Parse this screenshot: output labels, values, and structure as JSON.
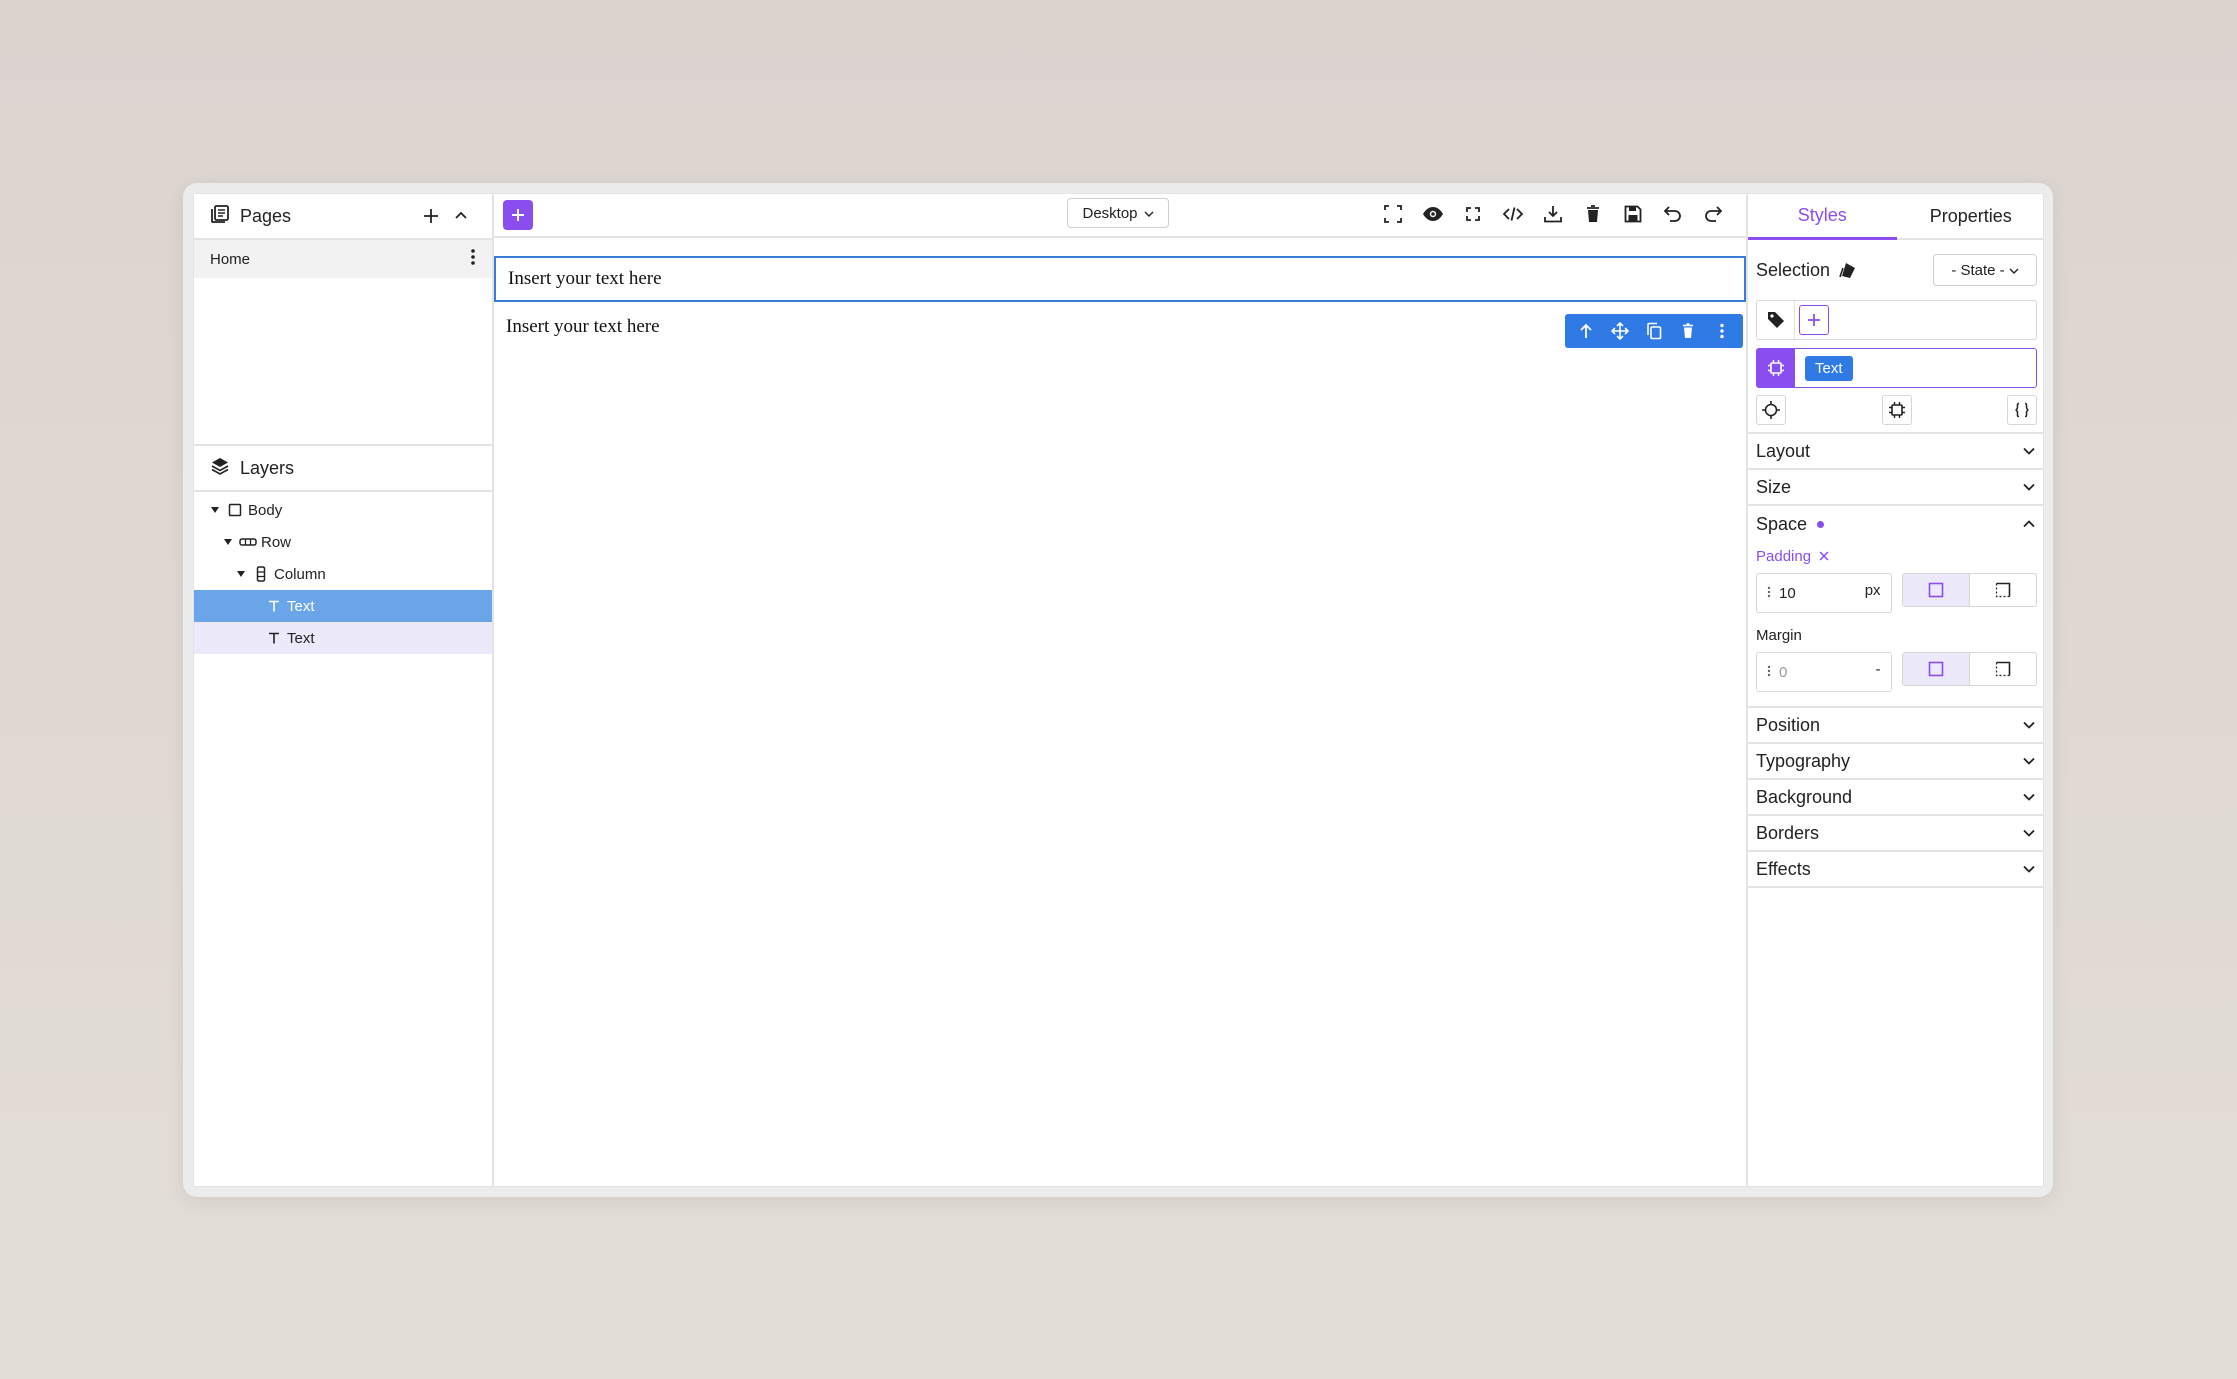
{
  "left": {
    "pages_title": "Pages",
    "pages": [
      {
        "label": "Home"
      }
    ],
    "layers_title": "Layers",
    "layers": [
      {
        "label": "Body",
        "depth": 0
      },
      {
        "label": "Row",
        "depth": 1
      },
      {
        "label": "Column",
        "depth": 2
      },
      {
        "label": "Text",
        "depth": 3
      },
      {
        "label": "Text",
        "depth": 3
      }
    ]
  },
  "toolbar": {
    "device": "Desktop"
  },
  "canvas": {
    "text1": "Insert your text here",
    "text2": "Insert your text here"
  },
  "right": {
    "tabs": [
      "Styles",
      "Properties"
    ],
    "selection_label": "Selection",
    "state_label": "- State -",
    "selected_chip": "Text",
    "sections": {
      "layout": "Layout",
      "size": "Size",
      "space": "Space",
      "position": "Position",
      "typography": "Typography",
      "background": "Background",
      "borders": "Borders",
      "effects": "Effects"
    },
    "padding": {
      "label": "Padding",
      "value": "10",
      "unit": "px"
    },
    "margin": {
      "label": "Margin",
      "value": "0",
      "unit": "-"
    }
  },
  "colors": {
    "accent": "#8a4df0",
    "selection_blue": "#2f7ae5",
    "layer_selected": "#6aa5e9"
  }
}
